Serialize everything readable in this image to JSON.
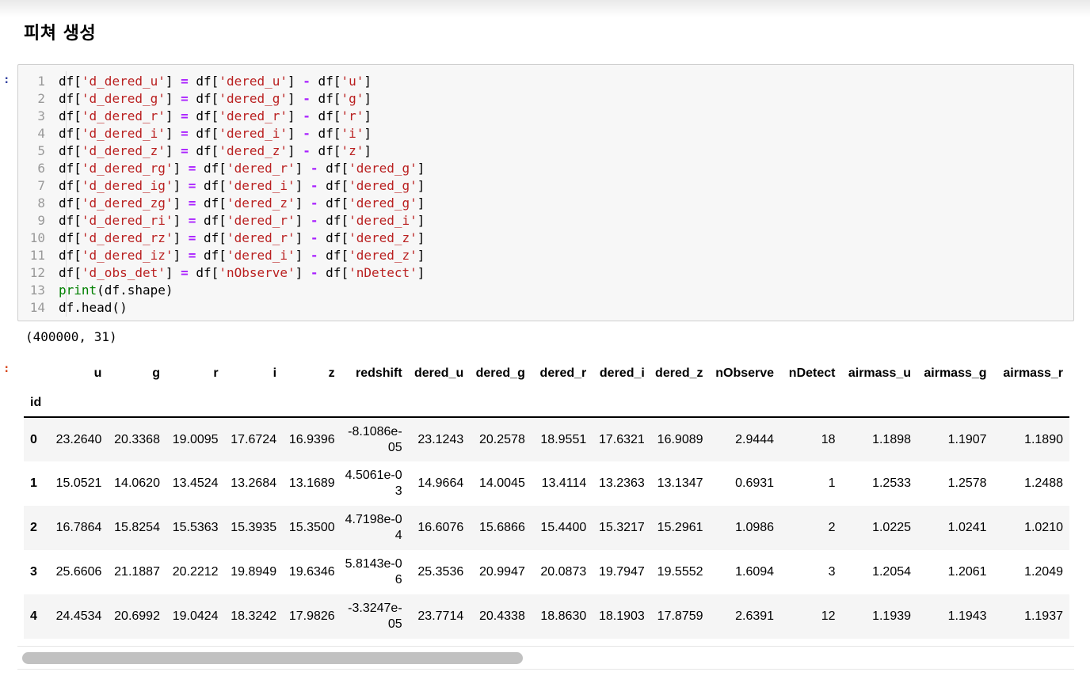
{
  "heading": "피쳐 생성",
  "markers": {
    "input": ":",
    "output": ":"
  },
  "code_lines": [
    {
      "num": "1",
      "code": "df['d_dered_u'] = df['dered_u'] - df['u']"
    },
    {
      "num": "2",
      "code": "df['d_dered_g'] = df['dered_g'] - df['g']"
    },
    {
      "num": "3",
      "code": "df['d_dered_r'] = df['dered_r'] - df['r']"
    },
    {
      "num": "4",
      "code": "df['d_dered_i'] = df['dered_i'] - df['i']"
    },
    {
      "num": "5",
      "code": "df['d_dered_z'] = df['dered_z'] - df['z']"
    },
    {
      "num": "6",
      "code": "df['d_dered_rg'] = df['dered_r'] - df['dered_g']"
    },
    {
      "num": "7",
      "code": "df['d_dered_ig'] = df['dered_i'] - df['dered_g']"
    },
    {
      "num": "8",
      "code": "df['d_dered_zg'] = df['dered_z'] - df['dered_g']"
    },
    {
      "num": "9",
      "code": "df['d_dered_ri'] = df['dered_r'] - df['dered_i']"
    },
    {
      "num": "10",
      "code": "df['d_dered_rz'] = df['dered_r'] - df['dered_z']"
    },
    {
      "num": "11",
      "code": "df['d_dered_iz'] = df['dered_i'] - df['dered_z']"
    },
    {
      "num": "12",
      "code": "df['d_obs_det'] = df['nObserve'] - df['nDetect']"
    },
    {
      "num": "13",
      "code": "print(df.shape)"
    },
    {
      "num": "14",
      "code": "df.head()"
    }
  ],
  "stream_output": "(400000, 31)",
  "dataframe": {
    "index_name": "id",
    "columns": [
      "u",
      "g",
      "r",
      "i",
      "z",
      "redshift",
      "dered_u",
      "dered_g",
      "dered_r",
      "dered_i",
      "dered_z",
      "nObserve",
      "nDetect",
      "airmass_u",
      "airmass_g",
      "airmass_r"
    ],
    "rows": [
      {
        "index": "0",
        "cells": [
          "23.2640",
          "20.3368",
          "19.0095",
          "17.6724",
          "16.9396",
          "-8.1086e-05",
          "23.1243",
          "20.2578",
          "18.9551",
          "17.6321",
          "16.9089",
          "2.9444",
          "18",
          "1.1898",
          "1.1907",
          "1.1890"
        ]
      },
      {
        "index": "1",
        "cells": [
          "15.0521",
          "14.0620",
          "13.4524",
          "13.2684",
          "13.1689",
          "4.5061e-03",
          "14.9664",
          "14.0045",
          "13.4114",
          "13.2363",
          "13.1347",
          "0.6931",
          "1",
          "1.2533",
          "1.2578",
          "1.2488"
        ]
      },
      {
        "index": "2",
        "cells": [
          "16.7864",
          "15.8254",
          "15.5363",
          "15.3935",
          "15.3500",
          "4.7198e-04",
          "16.6076",
          "15.6866",
          "15.4400",
          "15.3217",
          "15.2961",
          "1.0986",
          "2",
          "1.0225",
          "1.0241",
          "1.0210"
        ]
      },
      {
        "index": "3",
        "cells": [
          "25.6606",
          "21.1887",
          "20.2212",
          "19.8949",
          "19.6346",
          "5.8143e-06",
          "25.3536",
          "20.9947",
          "20.0873",
          "19.7947",
          "19.5552",
          "1.6094",
          "3",
          "1.2054",
          "1.2061",
          "1.2049"
        ]
      },
      {
        "index": "4",
        "cells": [
          "24.4534",
          "20.6992",
          "19.0424",
          "18.3242",
          "17.9826",
          "-3.3247e-05",
          "23.7714",
          "20.4338",
          "18.8630",
          "18.1903",
          "17.8759",
          "2.6391",
          "12",
          "1.1939",
          "1.1943",
          "1.1937"
        ]
      }
    ]
  },
  "scrollbar": {
    "position": 0.0
  }
}
